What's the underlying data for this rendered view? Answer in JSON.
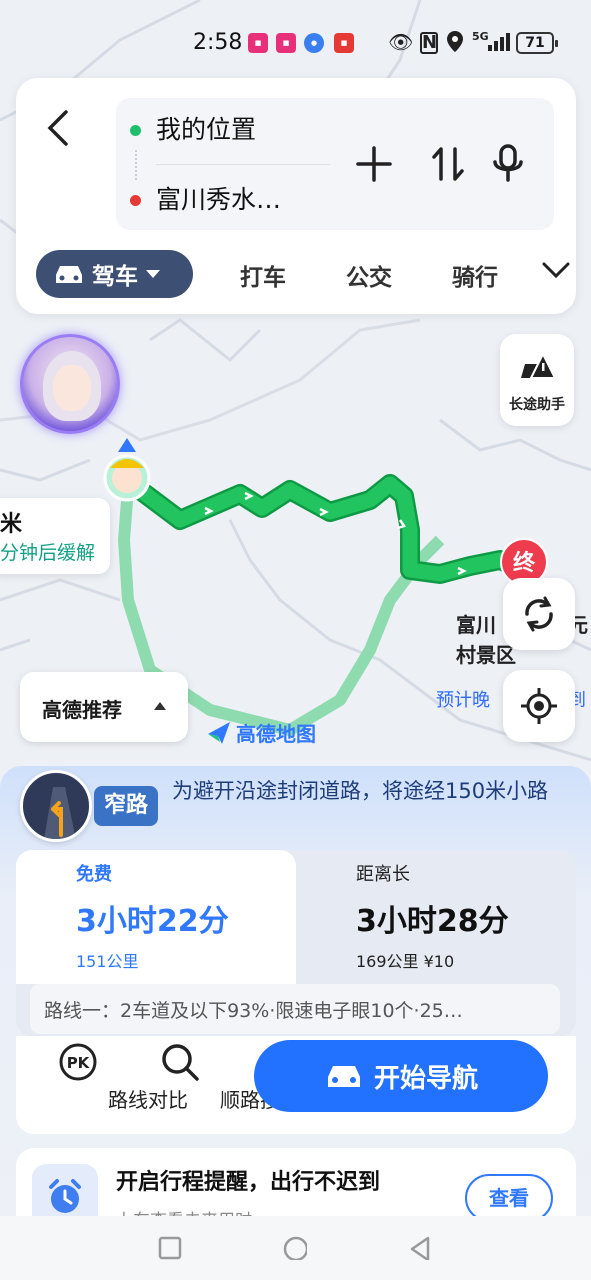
{
  "status_bar": {
    "time": "2:58",
    "network": "5G",
    "battery": "71",
    "notifications": [
      {
        "icon": "app-icon-1",
        "color": "#e8307a"
      },
      {
        "icon": "app-icon-2",
        "color": "#e8307a"
      },
      {
        "icon": "app-icon-3",
        "color": "#3a7ff0"
      },
      {
        "icon": "app-icon-4",
        "color": "#e53935"
      }
    ]
  },
  "search": {
    "origin": "我的位置",
    "destination": "富川秀水…",
    "origin_color": "#1fbf6b",
    "destination_color": "#e53935"
  },
  "modes": {
    "active": "驾车",
    "tabs": [
      "打车",
      "公交",
      "骑行"
    ]
  },
  "map": {
    "long_trip_helper": "长途助手",
    "traffic_line1": "米",
    "traffic_line2": "分钟后缓解",
    "end_marker": "终",
    "dest_line1": "富川",
    "dest_line1_cont": "元",
    "dest_line2": "村景区",
    "eta": "预计晚",
    "eta_cont": "到",
    "recommend": "高德推荐",
    "logo": "高德地图",
    "route_color": "#17b65a",
    "alt_route_color": "#8fdbb0"
  },
  "notice": {
    "badge": "窄路",
    "text": "为避开沿途封闭道路，将途经150米小路"
  },
  "routes": [
    {
      "tag": "免费",
      "time": "3小时22分",
      "sub": "151公里",
      "active": true
    },
    {
      "tag": "距离长",
      "time": "3小时28分",
      "sub": "169公里 ¥10",
      "active": false
    }
  ],
  "route_info": "路线一：2车道及以下93%·限速电子眼10个·25…",
  "actions": {
    "compare": "路线对比",
    "along_search": "顺路搜",
    "start": "开始导航"
  },
  "reminder": {
    "title": "开启行程提醒，出行不迟到",
    "subtitle": "上车查看未来用时",
    "button": "查看"
  }
}
